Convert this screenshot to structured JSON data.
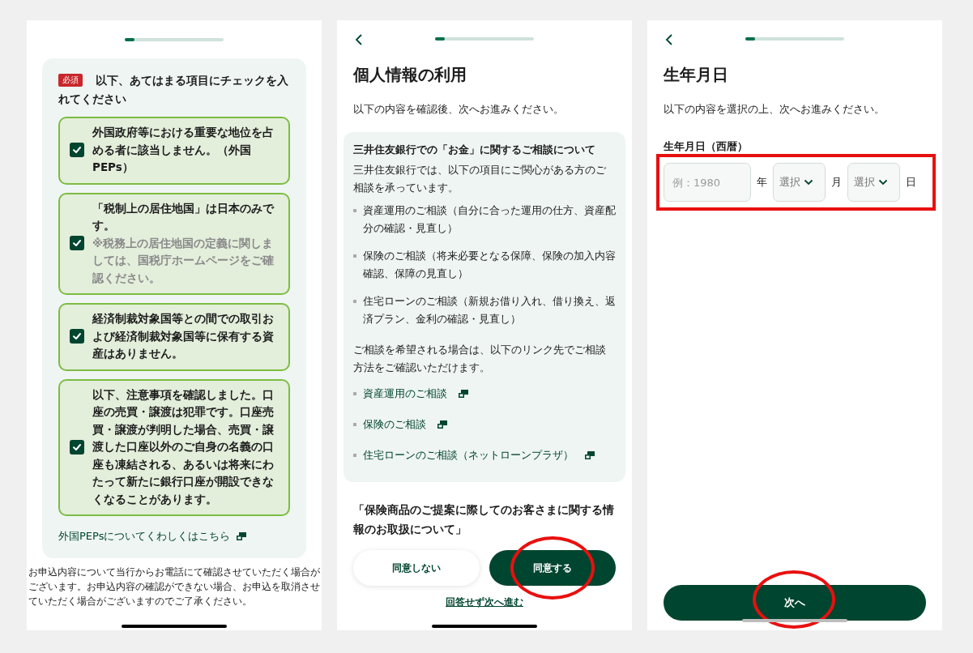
{
  "checklist_screen": {
    "progress": {
      "level": 0.1
    },
    "required_badge": "必須",
    "instruction": "以下、あてはまる項目にチェックを入れてください",
    "items": [
      {
        "text": "外国政府等における重要な地位を占める者に該当しません。（外国PEPs）",
        "checked": true
      },
      {
        "text": "「税制上の居住地国」は日本のみです。",
        "note": "※税務上の居住地国の定義に関しましては、国税庁ホームページをご確認ください。",
        "checked": true
      },
      {
        "text": "経済制裁対象国等との間での取引および経済制裁対象国等に保有する資産はありません。",
        "checked": true
      },
      {
        "text": "以下、注意事項を確認しました。口座の売買・譲渡は犯罪です。口座売買・譲渡が判明した場合、売買・譲渡した口座以外のご自身の名義の口座も凍結される、あるいは将来にわたって新たに銀行口座が開設できなくなることがあります。",
        "checked": true
      }
    ],
    "link": "外国PEPsについてくわしくはこちら",
    "footer": "お申込内容について当行からお電話にて確認させていただく場合がございます。お申込内容の確認ができない場合、お申込を取消させていただく場合がございますのでご了承ください。"
  },
  "consent_screen": {
    "progress": {
      "level": 0.1
    },
    "title": "個人情報の利用",
    "subtitle": "以下の内容を確認後、次へお進みください。",
    "card": {
      "heading": "三井住友銀行での「お金」に関するご相談について",
      "intro": "三井住友銀行では、以下の項目にご関心がある方のご相談を承っています。",
      "topics": [
        "資産運用のご相談（自分に合った運用の仕方、資産配分の確認・見直し）",
        "保険のご相談（将来必要となる保障、保険の加入内容確認、保障の見直し）",
        "住宅ローンのご相談（新規お借り入れ、借り換え、返済プラン、金利の確認・見直し）"
      ],
      "guide": "ご相談を希望される場合は、以下のリンク先でご相談方法をご確認いただけます。",
      "links": [
        "資産運用のご相談",
        "保険のご相談",
        "住宅ローンのご相談（ネットローンプラザ）"
      ]
    },
    "section_heading": "「保険商品のご提案に際してのお客さまに関する情報のお取扱について」",
    "buttons": [
      {
        "label": "同意しない",
        "kind": "secondary",
        "highlighted": false
      },
      {
        "label": "同意する",
        "kind": "primary",
        "highlighted": true
      }
    ],
    "skip_link": "回答せず次へ進む"
  },
  "birthdate_screen": {
    "progress": {
      "level": 0.1
    },
    "title": "生年月日",
    "subtitle": "以下の内容を選択の上、次へお進みください。",
    "field_label": "生年月日（西暦）",
    "fields": {
      "highlighted": true,
      "year": {
        "placeholder": "例：1980",
        "unit": "年"
      },
      "month": {
        "value": "選択",
        "unit": "月"
      },
      "day": {
        "value": "選択",
        "unit": "日"
      }
    },
    "next_button": {
      "label": "次へ",
      "highlighted": true
    }
  }
}
